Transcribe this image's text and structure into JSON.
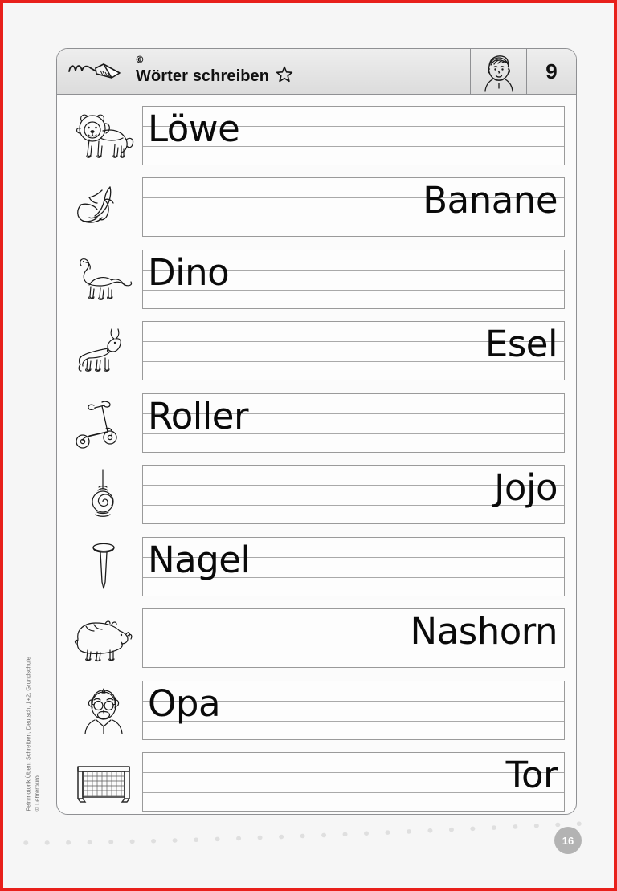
{
  "page": {
    "frame_color": "#e8201b",
    "background_color": "#f6f6f6",
    "badge_number": "16",
    "badge_color": "#b3b3b3"
  },
  "header": {
    "task_number": "⑥",
    "title": "Wörter schreiben",
    "star_icon": "star-outline-icon",
    "pencil_icon": "pencil-writing-icon",
    "avatar_icon": "boy-face-icon",
    "page_number": "9"
  },
  "credit": {
    "line1": "Feinmotorik Üben: Schreiben, Deutsch, 1+2, Grundschule",
    "line2": "© Lehrerbüro"
  },
  "exercises": [
    {
      "word": "Löwe",
      "align": "left",
      "icon": "lion-icon"
    },
    {
      "word": "Banane",
      "align": "right",
      "icon": "banana-icon"
    },
    {
      "word": "Dino",
      "align": "left",
      "icon": "dinosaur-icon"
    },
    {
      "word": "Esel",
      "align": "right",
      "icon": "donkey-icon"
    },
    {
      "word": "Roller",
      "align": "left",
      "icon": "scooter-icon"
    },
    {
      "word": "Jojo",
      "align": "right",
      "icon": "yoyo-icon"
    },
    {
      "word": "Nagel",
      "align": "left",
      "icon": "nail-icon"
    },
    {
      "word": "Nashorn",
      "align": "right",
      "icon": "rhinoceros-icon"
    },
    {
      "word": "Opa",
      "align": "left",
      "icon": "grandfather-icon"
    },
    {
      "word": "Tor",
      "align": "right",
      "icon": "soccer-goal-icon"
    }
  ]
}
